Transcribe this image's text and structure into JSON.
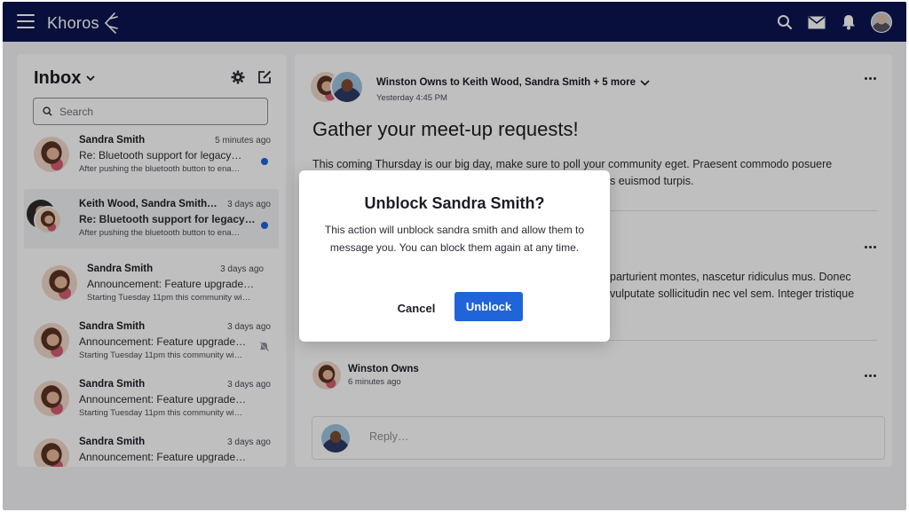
{
  "topbar": {
    "brand": "Khoros",
    "icons": [
      "menu-icon",
      "search-icon",
      "mail-icon",
      "bell-icon",
      "user-avatar"
    ]
  },
  "inbox": {
    "title": "Inbox",
    "search_placeholder": "Search",
    "conversations": [
      {
        "name": "Sandra Smith",
        "time": "5 minutes ago",
        "subject": "Re: Bluetooth support for legacy…",
        "preview": "After pushing the bluetooth button to ena…",
        "unread": true,
        "bold": false
      },
      {
        "name": "Keith Wood, Sandra Smith…",
        "time": "3 days ago",
        "subject": "Re: Bluetooth support for legacy…",
        "preview": "After pushing the bluetooth button to ena…",
        "unread": true,
        "bold": true
      },
      {
        "name": "Sandra Smith",
        "time": "3 days ago",
        "subject": "Announcement: Feature upgrade…",
        "preview": "Starting Tuesday 11pm this community wi…",
        "unread": false,
        "bold": false
      },
      {
        "name": "Sandra Smith",
        "time": "3 days ago",
        "subject": "Announcement: Feature upgrade…",
        "preview": "Starting Tuesday 11pm this community wi…",
        "unread": false,
        "muted": true,
        "bold": false
      },
      {
        "name": "Sandra Smith",
        "time": "3 days ago",
        "subject": "Announcement: Feature upgrade…",
        "preview": "Starting Tuesday 11pm this community wi…",
        "unread": false,
        "bold": false
      },
      {
        "name": "Sandra Smith",
        "time": "3 days ago",
        "subject": "Announcement: Feature upgrade…",
        "preview": "",
        "unread": false,
        "bold": false
      }
    ]
  },
  "thread": {
    "participants": "Winston Owns to Keith Wood, Sandra Smith + 5 more",
    "time": "Yesterday 4:45 PM",
    "title": "Gather your meet-up requests!",
    "para1_line1": "This coming Thursday is our big day, make sure to poll your community eget. Praesent commodo posuere",
    "para1_line2": "s euismod turpis.",
    "para2_line1": "parturient montes, nascetur ridiculus mus. Donec",
    "para2_line2": "vulputate sollicitudin nec vel sem. Integer tristique",
    "message_author": "Winston Owns",
    "message_time": "6 minutes ago",
    "reply_placeholder": "Reply…"
  },
  "modal": {
    "title": "Unblock Sandra Smith?",
    "body": "This action will unblock sandra smith and allow them to message you. You can block them again at any time.",
    "cancel_label": "Cancel",
    "confirm_label": "Unblock"
  },
  "colors": {
    "topbar": "#0d1451",
    "primary": "#1f64d8",
    "unread_dot": "#1f64d8"
  }
}
